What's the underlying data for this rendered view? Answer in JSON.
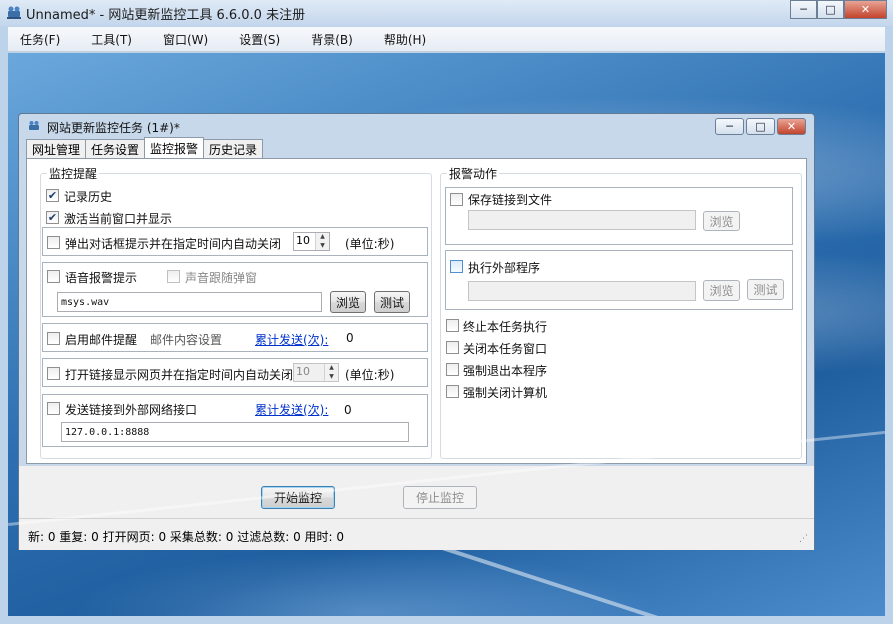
{
  "app": {
    "title": "Unnamed* - 网站更新监控工具 6.6.0.0 未注册",
    "window_buttons": {
      "minimize": "─",
      "maximize": "□",
      "close": "✕"
    }
  },
  "menu": [
    "任务(F)",
    "工具(T)",
    "窗口(W)",
    "设置(S)",
    "背景(B)",
    "帮助(H)"
  ],
  "child": {
    "title": "网站更新监控任务  (1#)*",
    "window_buttons": {
      "minimize": "─",
      "maximize": "□",
      "close": "✕"
    },
    "tabs": [
      "网址管理",
      "任务设置",
      "监控报警",
      "历史记录"
    ],
    "active_tab": "监控报警"
  },
  "monitor_alert": {
    "group_title": "监控提醒",
    "record_history": {
      "label": "记录历史",
      "checked": true
    },
    "activate_window": {
      "label": "激活当前窗口并显示",
      "checked": true
    },
    "popup_dialog": {
      "label": "弹出对话框提示并在指定时间内自动关闭",
      "checked": false,
      "seconds": "10",
      "unit": "(单位:秒)"
    },
    "voice_alert": {
      "label": "语音报警提示",
      "checked": false,
      "follow_popup_label": "声音跟随弹窗",
      "sound_file": "msys.wav",
      "browse_label": "浏览",
      "test_label": "测试"
    },
    "email_alert": {
      "label": "启用邮件提醒",
      "checked": false,
      "content_settings": "邮件内容设置",
      "sent_link": "累计发送(次):",
      "sent_count": "0"
    },
    "open_link": {
      "label": "打开链接显示网页并在指定时间内自动关闭",
      "checked": false,
      "seconds": "10",
      "unit": "(单位:秒)"
    },
    "send_link": {
      "label": "发送链接到外部网络接口",
      "checked": false,
      "sent_link": "累计发送(次):",
      "sent_count": "0",
      "endpoint": "127.0.0.1:8888"
    }
  },
  "alarm_action": {
    "group_title": "报警动作",
    "save_links": {
      "label": "保存链接到文件",
      "checked": false,
      "path": "",
      "browse_label": "浏览"
    },
    "run_program": {
      "label": "执行外部程序",
      "checked": false,
      "path": "",
      "browse_label": "浏览",
      "test_label": "测试"
    },
    "stop_task": {
      "label": "终止本任务执行",
      "checked": false
    },
    "close_task_window": {
      "label": "关闭本任务窗口",
      "checked": false
    },
    "exit_program": {
      "label": "强制退出本程序",
      "checked": false
    },
    "shutdown": {
      "label": "强制关闭计算机",
      "checked": false
    }
  },
  "actions": {
    "start": "开始监控",
    "stop": "停止监控"
  },
  "status_bar": "新: 0  重复: 0  打开网页: 0  采集总数: 0  过滤总数: 0  用时: 0",
  "grip": "⋰"
}
